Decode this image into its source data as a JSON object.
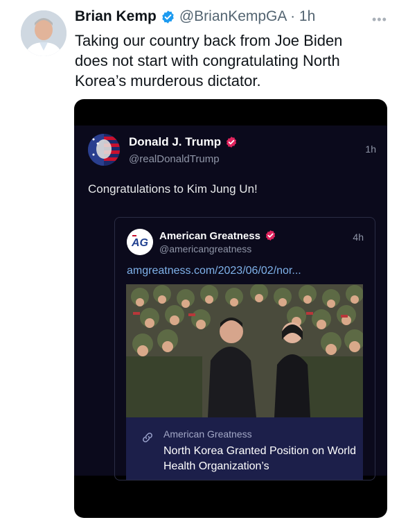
{
  "tweet": {
    "author_name": "Brian Kemp",
    "handle_time": "@BrianKempGA · 1h",
    "more_icon": "more-horizontal-icon",
    "text": "Taking our country back from Joe Biden does not start with congratulating North Korea’s murderous dictator."
  },
  "embedded_post": {
    "author_name": "Donald J. Trump",
    "handle": "@realDonaldTrump",
    "time": "1h",
    "text": "Congratulations to Kim Jung Un!",
    "quoted_post": {
      "avatar_text": "AG",
      "author_name": "American Greatness",
      "handle": "@americangreatness",
      "time": "4h",
      "link": "amgreatness.com/2023/06/02/nor...",
      "card": {
        "source": "American Greatness",
        "title": "North Korea Granted Position on World Health Organization’s"
      }
    }
  },
  "colors": {
    "verified_blue": "#1d9bf0",
    "truth_badge": "#e0245e",
    "media_bg": "#0b0a1c",
    "link": "#7fb2ea"
  }
}
